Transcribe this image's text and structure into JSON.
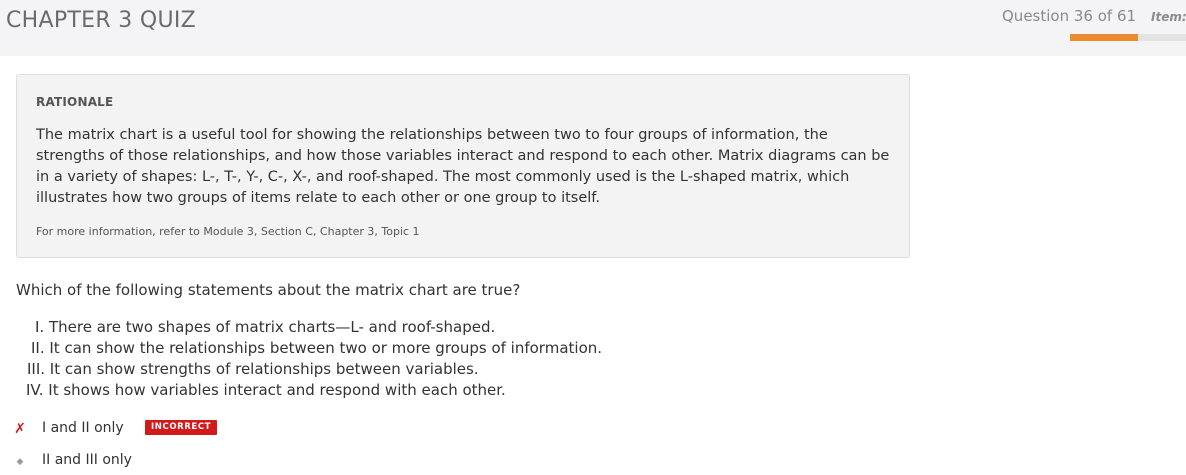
{
  "header": {
    "title": "CHAPTER 3 QUIZ",
    "question_counter": "Question 36 of 61",
    "item_label": "Item:",
    "progress_fraction": 0.59,
    "progress_color": "#ed8a2b"
  },
  "rationale": {
    "heading": "RATIONALE",
    "body": "The matrix chart is a useful tool for showing the relationships between two to four groups of information, the strengths of those relationships, and how those variables interact and respond to each other. Matrix diagrams can be in a variety of shapes: L-, T-, Y-, C-, X-, and roof-shaped. The most commonly used is the L-shaped matrix, which illustrates how two groups of items relate to each other or one group to itself.",
    "reference": "For more information, refer to Module 3, Section C, Chapter 3, Topic 1"
  },
  "question": {
    "stem": "Which of the following statements about the matrix chart are true?",
    "statements": [
      "I. There are two shapes of matrix charts—L- and roof-shaped.",
      "II. It can show the relationships between two or more groups of information.",
      "III. It can show strengths of relationships between variables.",
      "IV. It shows how variables interact and respond with each other."
    ],
    "choices": [
      {
        "label": "I and II only",
        "marker": "✗",
        "badge": "INCORRECT"
      },
      {
        "label": "II and III only",
        "marker": "◆"
      }
    ]
  }
}
